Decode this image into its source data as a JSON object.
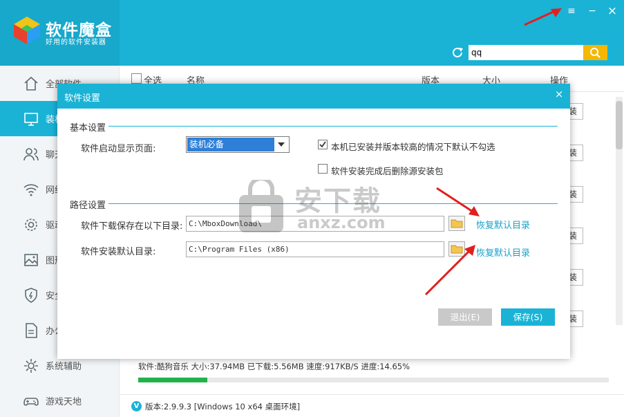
{
  "app": {
    "title": "软件魔盒",
    "subtitle": "好用的软件安装器"
  },
  "window_controls": {
    "menu": "≡",
    "minimize": "−",
    "close": "×"
  },
  "search": {
    "value": "qq"
  },
  "sidebar": {
    "items": [
      {
        "label": "全部软件",
        "icon": "home-icon"
      },
      {
        "label": "装机必备",
        "icon": "monitor-icon",
        "active": true
      },
      {
        "label": "聊天工具",
        "icon": "users-icon"
      },
      {
        "label": "网络应用",
        "icon": "wifi-icon"
      },
      {
        "label": "驱动工具",
        "icon": "gear-icon"
      },
      {
        "label": "图形图像",
        "icon": "image-icon"
      },
      {
        "label": "安全软件",
        "icon": "shield-icon"
      },
      {
        "label": "办公软件",
        "icon": "document-icon"
      },
      {
        "label": "系统辅助",
        "icon": "settings-icon"
      },
      {
        "label": "游戏天地",
        "icon": "gamepad-icon"
      }
    ]
  },
  "table": {
    "headers": {
      "select_all": "全选",
      "name": "名称",
      "version": "版本",
      "size": "大小",
      "action": "操作"
    },
    "row_action_label": "装"
  },
  "download": {
    "status": "软件:酷狗音乐 大小:37.94MB 已下载:5.56MB 速度:917KB/S 进度:14.65%",
    "progress": 0.1465
  },
  "footer": {
    "badge": "V",
    "text": "版本:2.9.9.3 [Windows 10 x64 桌面环境]"
  },
  "dialog": {
    "title": "软件设置",
    "close": "×",
    "basic": {
      "heading": "基本设置",
      "startup_label": "软件启动显示页面:",
      "startup_value": "装机必备",
      "opt_no_check_label": "本机已安装并版本较高的情况下默认不勾选",
      "opt_no_check": true,
      "opt_delete_label": "软件安装完成后删除源安装包",
      "opt_delete": false
    },
    "paths": {
      "heading": "路径设置",
      "download_label": "软件下载保存在以下目录:",
      "download_path": "C:\\MboxDownload\\",
      "install_label": "软件安装默认目录:",
      "install_path": "C:\\Program Files (x86)",
      "restore_label": "恢复默认目录"
    },
    "buttons": {
      "exit": "退出(E)",
      "save": "保存(S)"
    }
  },
  "watermark": {
    "text": "安下载",
    "sub": "anxz.com"
  },
  "colors": {
    "accent": "#1ab3d6",
    "progress": "#22b24c",
    "search_button": "#f5b700",
    "arrow": "#e02020"
  }
}
